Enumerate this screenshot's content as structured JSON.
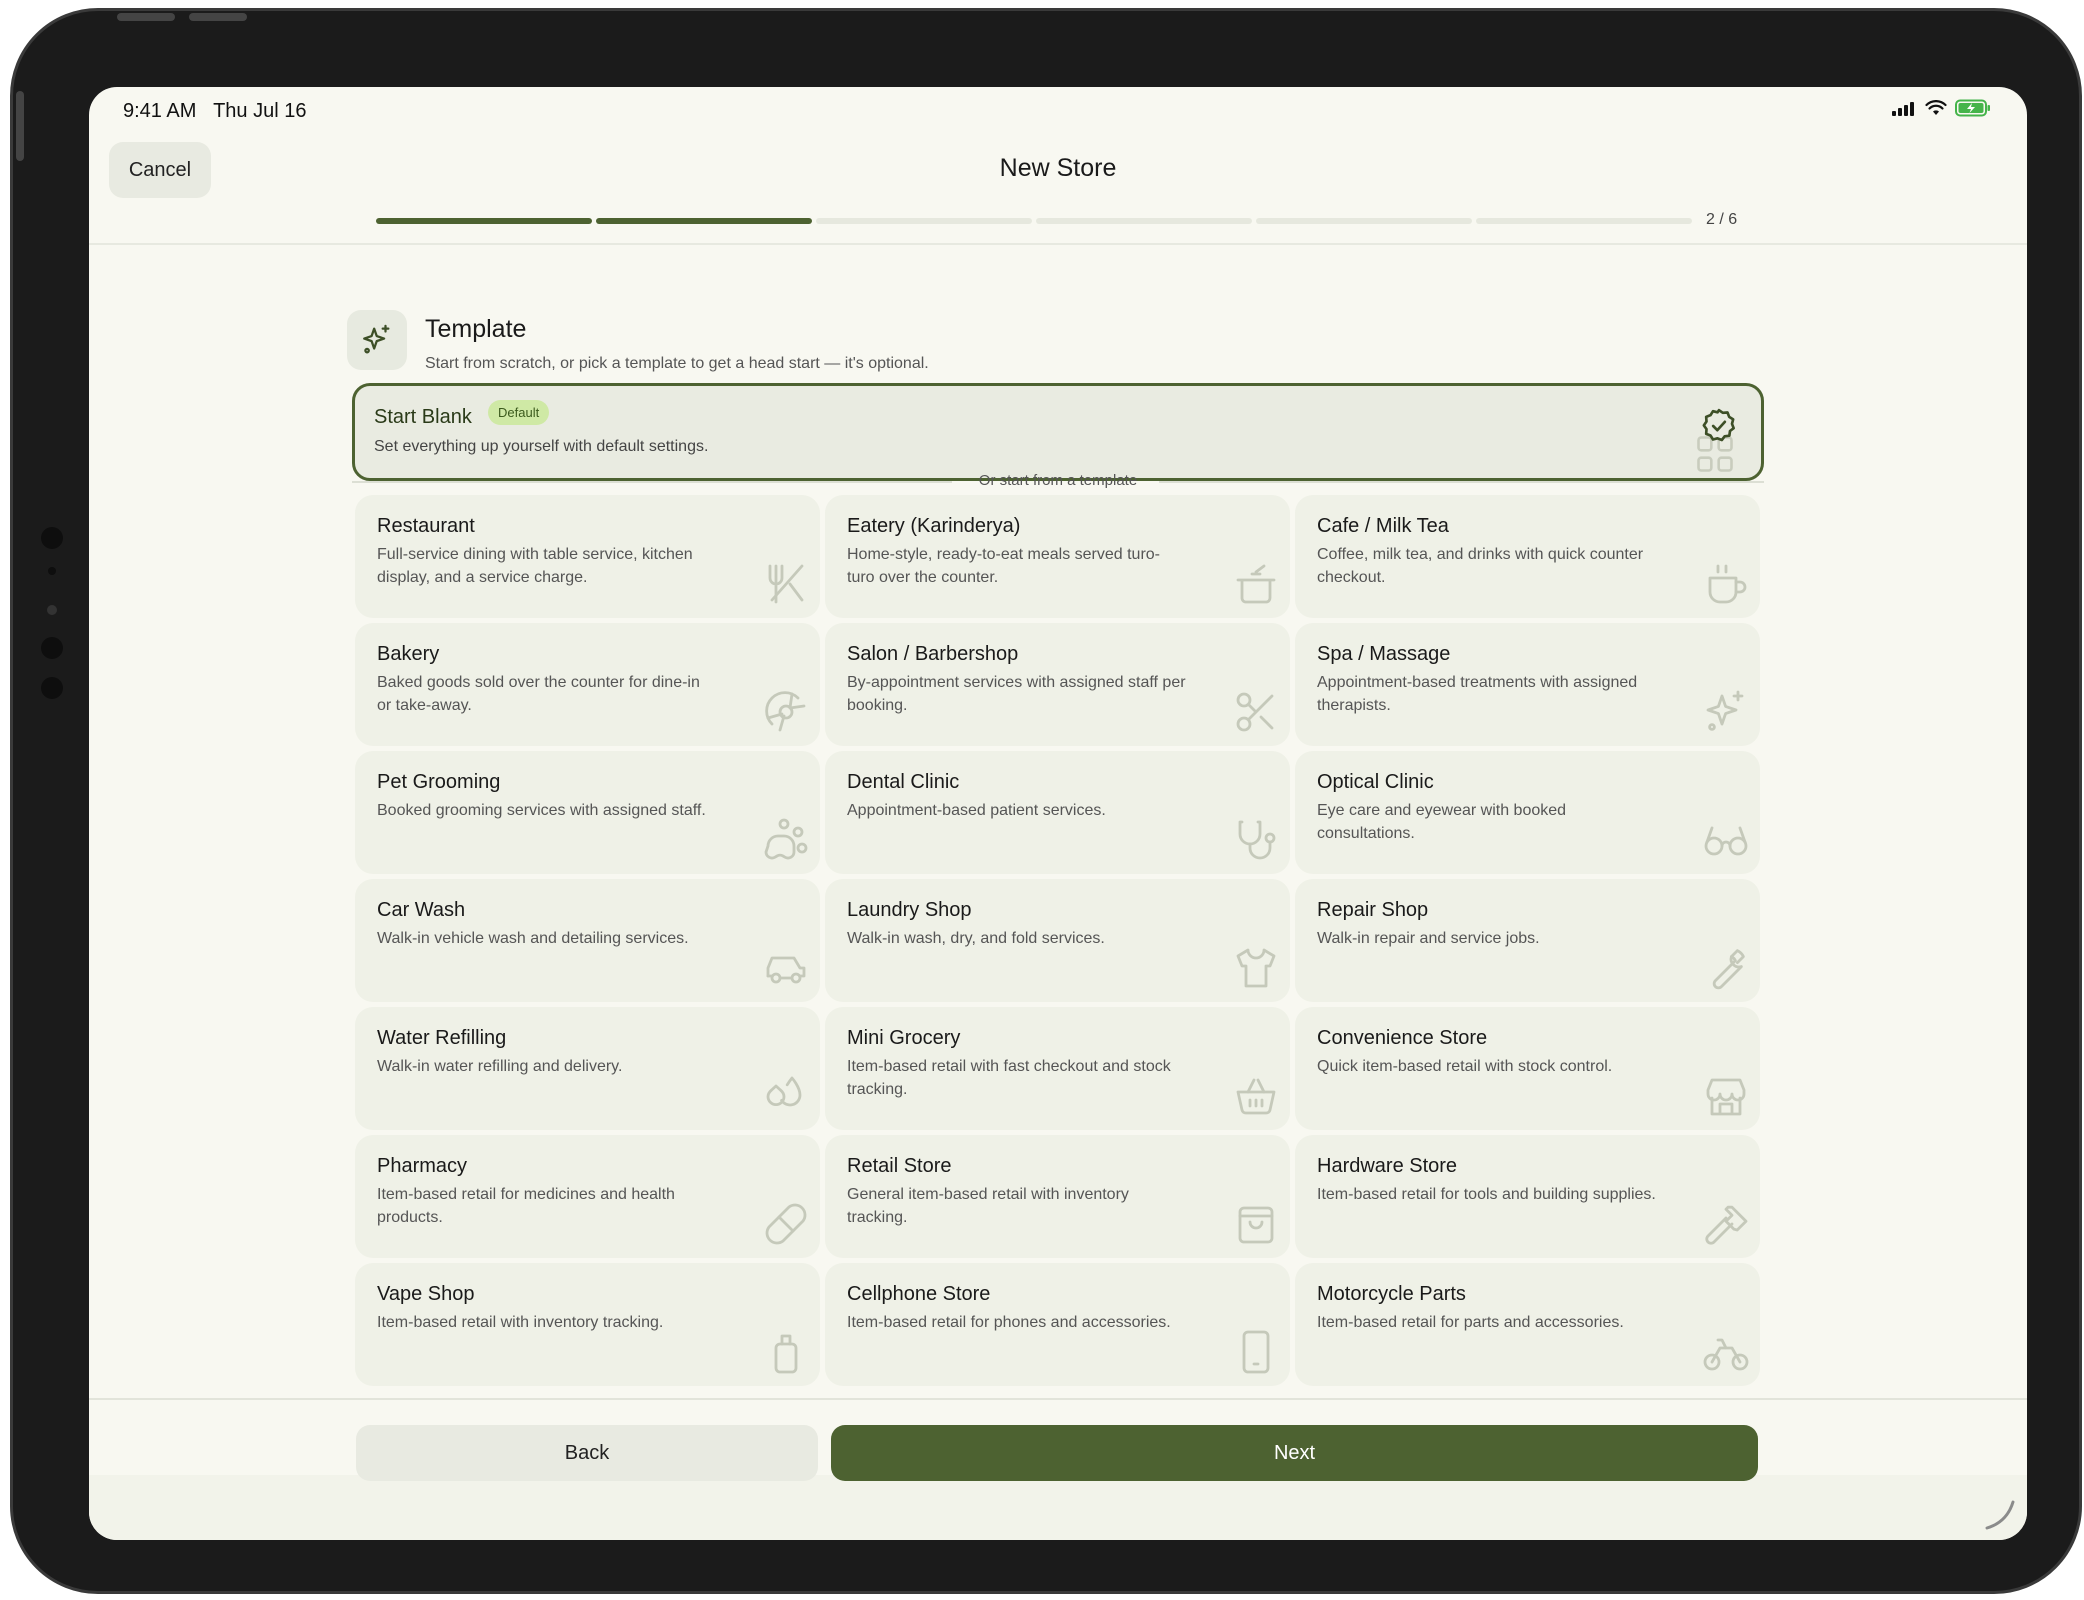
{
  "status_bar": {
    "time": "9:41 AM",
    "date": "Thu Jul 16",
    "icons": [
      "signal-icon",
      "wifi-icon",
      "battery-icon"
    ]
  },
  "header": {
    "cancel_label": "Cancel",
    "title": "New Store",
    "step_text": "2 / 6",
    "steps_total": 6,
    "steps_done": 2
  },
  "section": {
    "icon": "sparkle-icon",
    "title": "Template",
    "subtitle": "Start from scratch, or pick a template to get a head start — it's optional."
  },
  "blank_option": {
    "title": "Start Blank",
    "badge": "Default",
    "description": "Set everything up yourself with default settings.",
    "selected": true
  },
  "divider_text": "Or start from a template",
  "templates": [
    {
      "name": "Restaurant",
      "description": "Full-service dining with table service, kitchen display, and a service charge.",
      "icon": "utensils-icon"
    },
    {
      "name": "Eatery (Karinderya)",
      "description": "Home-style, ready-to-eat meals served turo-turo over the counter.",
      "icon": "cooking-pot-icon"
    },
    {
      "name": "Cafe / Milk Tea",
      "description": "Coffee, milk tea, and drinks with quick counter checkout.",
      "icon": "coffee-cup-icon"
    },
    {
      "name": "Bakery",
      "description": "Baked goods sold over the counter for dine-in or take-away.",
      "icon": "croissant-icon"
    },
    {
      "name": "Salon / Barbershop",
      "description": "By-appointment services with assigned staff per booking.",
      "icon": "scissors-icon"
    },
    {
      "name": "Spa / Massage",
      "description": "Appointment-based treatments with assigned therapists.",
      "icon": "sparkle-icon"
    },
    {
      "name": "Pet Grooming",
      "description": "Booked grooming services with assigned staff.",
      "icon": "paw-icon"
    },
    {
      "name": "Dental Clinic",
      "description": "Appointment-based patient services.",
      "icon": "stethoscope-icon"
    },
    {
      "name": "Optical Clinic",
      "description": "Eye care and eyewear with booked consultations.",
      "icon": "glasses-icon"
    },
    {
      "name": "Car Wash",
      "description": "Walk-in vehicle wash and detailing services.",
      "icon": "car-icon"
    },
    {
      "name": "Laundry Shop",
      "description": "Walk-in wash, dry, and fold services.",
      "icon": "shirt-icon"
    },
    {
      "name": "Repair Shop",
      "description": "Walk-in repair and service jobs.",
      "icon": "wrench-icon"
    },
    {
      "name": "Water Refilling",
      "description": "Walk-in water refilling and delivery.",
      "icon": "droplets-icon"
    },
    {
      "name": "Mini Grocery",
      "description": "Item-based retail with fast checkout and stock tracking.",
      "icon": "basket-icon"
    },
    {
      "name": "Convenience Store",
      "description": "Quick item-based retail with stock control.",
      "icon": "store-icon"
    },
    {
      "name": "Pharmacy",
      "description": "Item-based retail for medicines and health products.",
      "icon": "pill-icon"
    },
    {
      "name": "Retail Store",
      "description": "General item-based retail with inventory tracking.",
      "icon": "shopping-bag-icon"
    },
    {
      "name": "Hardware Store",
      "description": "Item-based retail for tools and building supplies.",
      "icon": "hammer-icon"
    },
    {
      "name": "Vape Shop",
      "description": "Item-based retail with inventory tracking.",
      "icon": "vape-icon"
    },
    {
      "name": "Cellphone Store",
      "description": "Item-based retail for phones and accessories.",
      "icon": "smartphone-icon"
    },
    {
      "name": "Motorcycle Parts",
      "description": "Item-based retail for parts and accessories.",
      "icon": "bike-icon"
    }
  ],
  "footer": {
    "back_label": "Back",
    "next_label": "Next"
  },
  "colors": {
    "accent": "#4d6231",
    "badge_bg": "#cfe9a5",
    "card_bg": "#eff1e7",
    "screen_bg": "#f8f8f1"
  }
}
